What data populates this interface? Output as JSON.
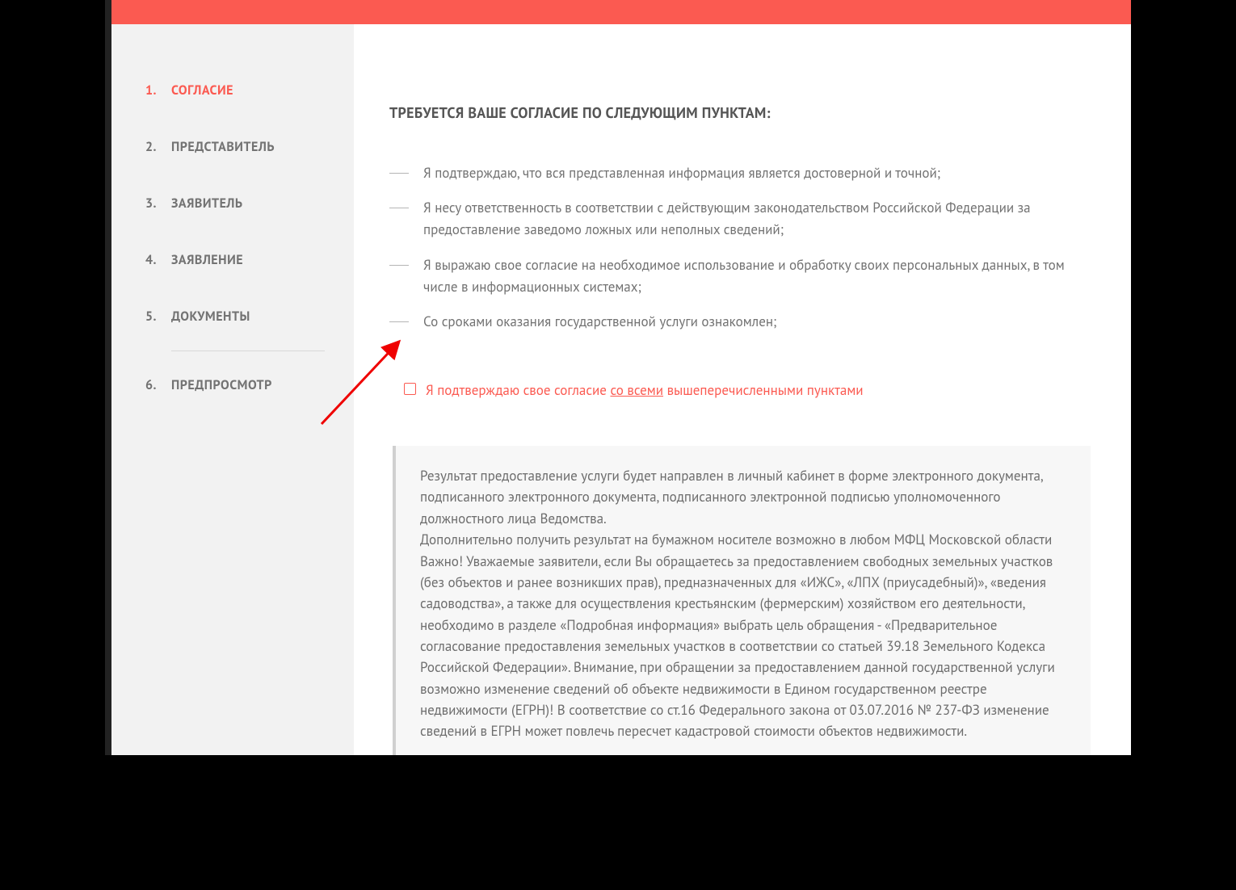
{
  "sidebar": {
    "steps": [
      {
        "num": "1.",
        "label": "СОГЛАСИЕ",
        "active": true
      },
      {
        "num": "2.",
        "label": "ПРЕДСТАВИТЕЛЬ",
        "active": false
      },
      {
        "num": "3.",
        "label": "ЗАЯВИТЕЛЬ",
        "active": false
      },
      {
        "num": "4.",
        "label": "ЗАЯВЛЕНИЕ",
        "active": false
      },
      {
        "num": "5.",
        "label": "ДОКУМЕНТЫ",
        "active": false
      },
      {
        "num": "6.",
        "label": "ПРЕДПРОСМОТР",
        "active": false
      }
    ]
  },
  "title": "ТРЕБУЕТСЯ ВАШЕ СОГЛАСИЕ ПО СЛЕДУЮЩИМ ПУНКТАМ:",
  "bullets": [
    "Я подтверждаю, что вся представленная информация является достоверной и точной;",
    "Я несу ответственность в соответствии с действующим законодательством Российской Федерации за предоставление заведомо ложных или неполных сведений;",
    "Я выражаю свое согласие на необходимое использование и обработку своих персональных данных, в том числе в информационных системах;",
    "Со сроками оказания государственной услуги ознакомлен;"
  ],
  "consent": {
    "prefix": "Я подтверждаю свое согласие ",
    "underline": "со всеми",
    "suffix": " вышеперечисленными пунктами"
  },
  "info": {
    "p1": "Результат предоставление услуги будет направлен в личный кабинет в форме электронного документа, подписанного электронного документа, подписанного электронной подписью уполномоченного должностного лица Ведомства.",
    "p2": "Дополнительно получить результат на бумажном носителе возможно в любом МФЦ Московской области",
    "p3": "Важно! Уважаемые заявители, если Вы обращаетесь за предоставлением свободных земельных участков (без объектов и ранее возникших прав), предназначенных для «ИЖС», «ЛПХ (приусадебный)», «ведения садоводства», а также для осуществления крестьянским (фермерским) хозяйством его деятельности, необходимо в разделе «Подробная информация» выбрать цель обращения - «Предварительное согласование предоставления земельных участков в соответствии со статьей 39.18 Земельного Кодекса Российской Федерации». Внимание, при обращении за предоставлением данной государственной услуги возможно изменение сведений об объекте недвижимости в Едином государственном реестре недвижимости (ЕГРН)! В соответствие со ст.16 Федерального закона от 03.07.2016 № 237-ФЗ изменение сведений в ЕГРН может повлечь пересчет кадастровой стоимости объектов недвижимости."
  }
}
